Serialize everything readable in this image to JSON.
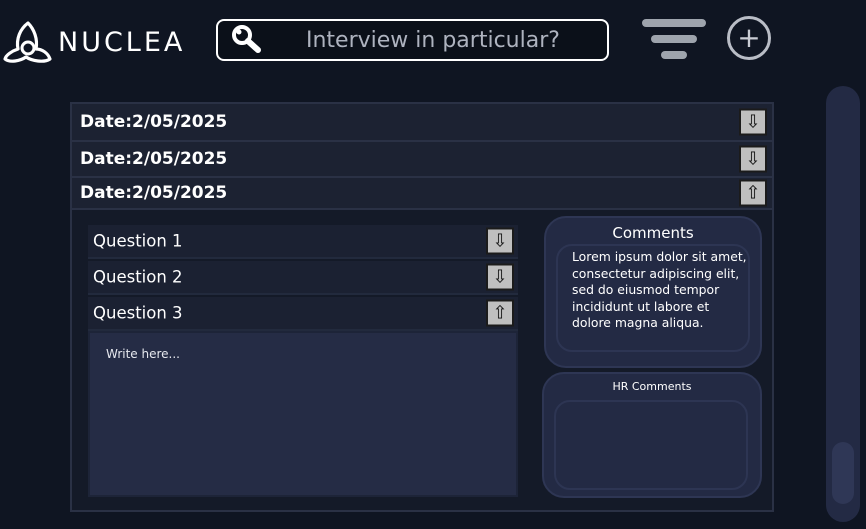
{
  "header": {
    "logo_text": "NUCLEA",
    "search_placeholder": "Interview in particular?",
    "filter_icon": "filter-lines-icon",
    "add_icon": "plus-circle-icon"
  },
  "dates": [
    {
      "label": "Date:2/05/2025",
      "arrow": "⇩",
      "expanded": false
    },
    {
      "label": "Date:2/05/2025",
      "arrow": "⇩",
      "expanded": false
    },
    {
      "label": "Date:2/05/2025",
      "arrow": "⇧",
      "expanded": true
    }
  ],
  "questions": [
    {
      "label": "Question 1",
      "arrow": "⇩",
      "expanded": false
    },
    {
      "label": "Question 2",
      "arrow": "⇩",
      "expanded": false
    },
    {
      "label": "Question 3",
      "arrow": "⇧",
      "expanded": true
    }
  ],
  "answer": {
    "placeholder": "Write here..."
  },
  "comments": {
    "title": "Comments",
    "text": "Lorem ipsum dolor sit amet, consectetur adipiscing elit, sed do eiusmod tempor incididunt ut labore et dolore magna aliqua."
  },
  "hr_comments": {
    "title": "HR Comments",
    "value": ""
  },
  "colors": {
    "background": "#0f1522",
    "panel": "#141a28",
    "card": "#232a44",
    "arrow_button": "#bfbfbf",
    "accent_white": "#ffffff"
  }
}
